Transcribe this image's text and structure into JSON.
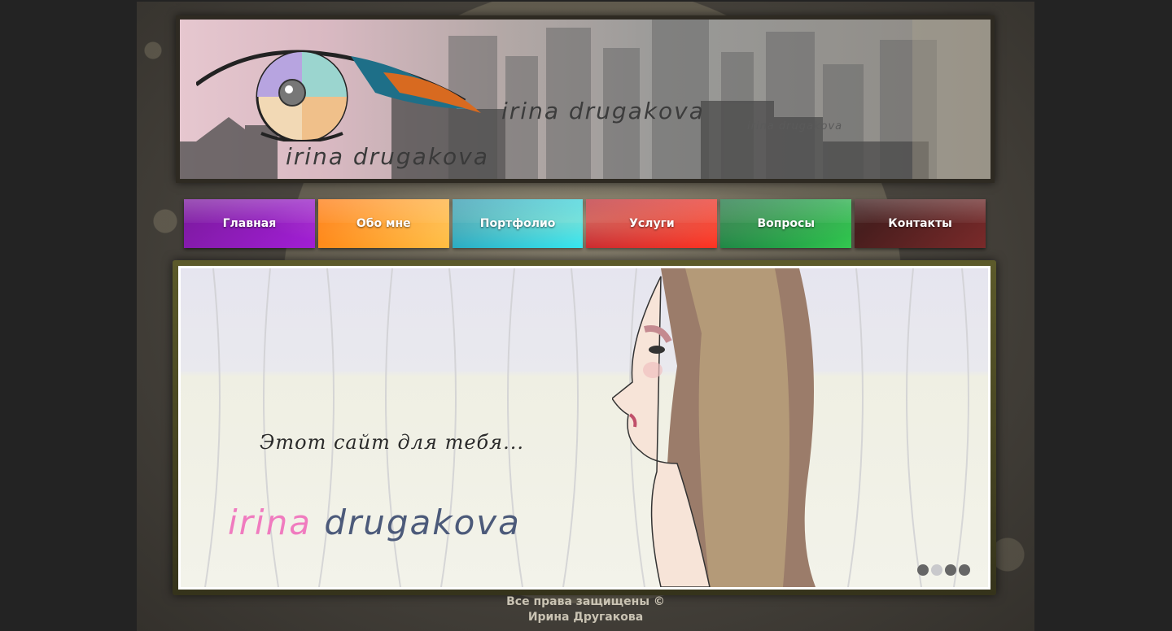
{
  "header": {
    "logo_text": "irina drugakova",
    "title_main": "irina drugakova",
    "title_small": "irina drugakova"
  },
  "nav": {
    "items": [
      {
        "label": "Главная",
        "colors": [
          "#7a1a9c",
          "#a21ed6"
        ]
      },
      {
        "label": "Обо мне",
        "colors": [
          "#ff7a10",
          "#ffbb3a"
        ]
      },
      {
        "label": "Портфолио",
        "colors": [
          "#1a8fb0",
          "#20e6f5"
        ]
      },
      {
        "label": "Услуги",
        "colors": [
          "#b01024",
          "#ff2a1a"
        ]
      },
      {
        "label": "Вопросы",
        "colors": [
          "#0a6a3a",
          "#34c850"
        ]
      },
      {
        "label": "Контакты",
        "colors": [
          "#3a1a1a",
          "#7a2a2a"
        ]
      }
    ]
  },
  "slider": {
    "tagline": "Этот сайт для тебя...",
    "name_first": "irina",
    "name_last": "drugakova",
    "dots": 4,
    "active_dot": 1
  },
  "footer": {
    "line1": "Все права защищены ©",
    "line2": "Ирина Другакова"
  }
}
